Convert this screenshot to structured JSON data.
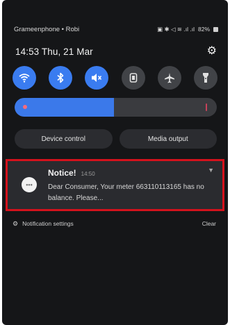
{
  "status_bar": {
    "carrier": "Grameenphone • Robi",
    "icons_text": "▣ ✱ ◁ ≋ .ıl .ıl",
    "battery": "82%"
  },
  "header": {
    "time_date": "14:53 Thu, 21 Mar",
    "settings_icon": "gear-icon"
  },
  "quick_settings": {
    "tiles": [
      {
        "icon": "wifi-icon",
        "state": "on"
      },
      {
        "icon": "bluetooth-icon",
        "state": "on"
      },
      {
        "icon": "mute-icon",
        "state": "on"
      },
      {
        "icon": "screen-rotation-icon",
        "state": "off"
      },
      {
        "icon": "airplane-icon",
        "state": "off"
      },
      {
        "icon": "flashlight-icon",
        "state": "off"
      }
    ],
    "brightness_level": 0.49,
    "device_control_label": "Device control",
    "media_output_label": "Media output"
  },
  "notification": {
    "title": "Notice!",
    "time": "14:50",
    "body": "Dear Consumer, Your meter 663110113165 has no balance. Please...",
    "highlight_color": "#d4121c"
  },
  "footer": {
    "settings_label": "Notification settings",
    "clear_label": "Clear"
  },
  "colors": {
    "accent": "#3a7cf0",
    "panel_bg": "#151618"
  }
}
